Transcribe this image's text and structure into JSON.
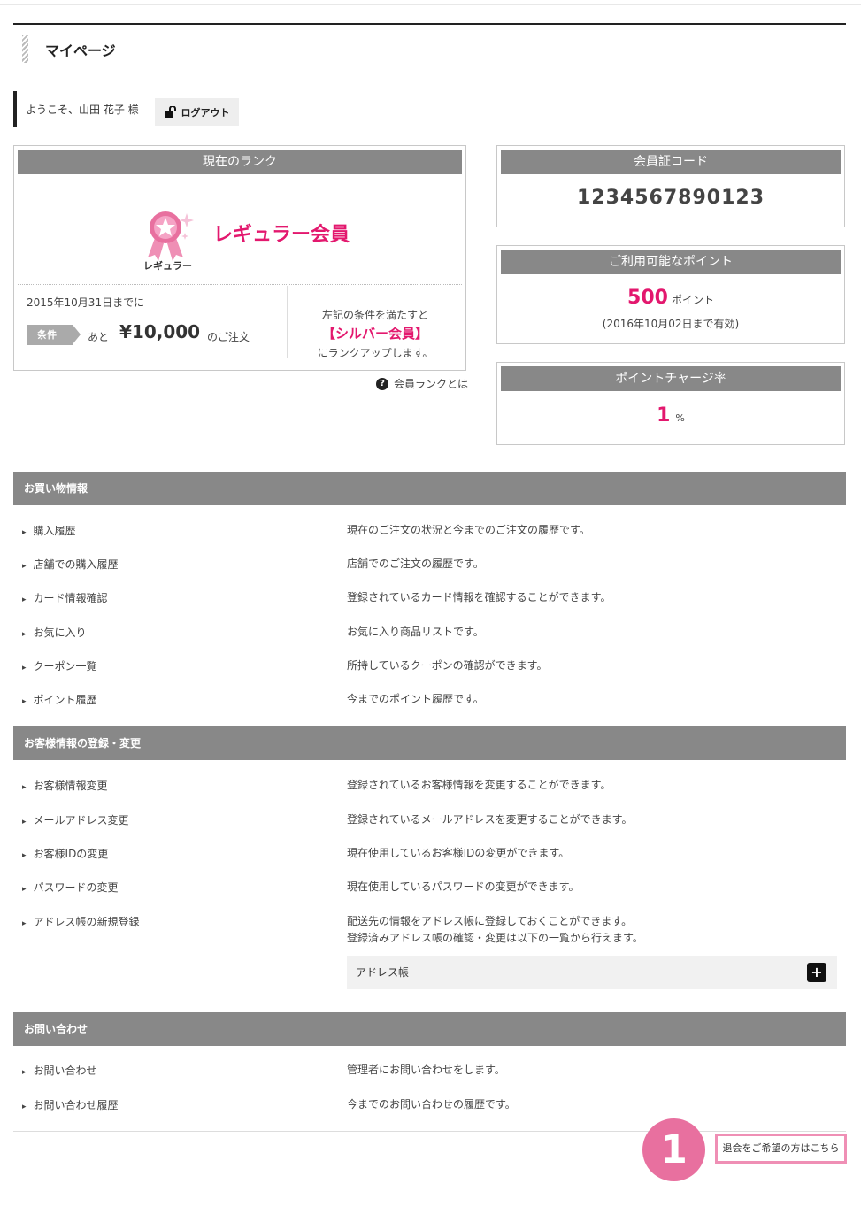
{
  "header": {
    "title": "マイページ"
  },
  "welcome": {
    "text": "ようこそ、山田 花子 様",
    "logout_label": "ログアウト"
  },
  "rank": {
    "heading": "現在のランク",
    "badge_label": "レギュラー",
    "name": "レギュラー会員",
    "deadline": "2015年10月31日までに",
    "condition_tag": "条件",
    "condition_pre": "あと",
    "condition_amount": "¥10,000",
    "condition_post": "のご注文",
    "upgrade_line1": "左記の条件を満たすと",
    "upgrade_rank": "【シルバー会員】",
    "upgrade_line3": "にランクアップします。",
    "help_link": "会員ランクとは"
  },
  "member_code": {
    "heading": "会員証コード",
    "value": "1234567890123"
  },
  "points": {
    "heading": "ご利用可能なポイント",
    "value": "500",
    "unit": "ポイント",
    "expiry": "(2016年10月02日まで有効)"
  },
  "charge_rate": {
    "heading": "ポイントチャージ率",
    "value": "1",
    "unit": "%"
  },
  "sections": [
    {
      "title": "お買い物情報",
      "items": [
        {
          "name": "購入履歴",
          "desc": "現在のご注文の状況と今までのご注文の履歴です。"
        },
        {
          "name": "店舗での購入履歴",
          "desc": "店舗でのご注文の履歴です。"
        },
        {
          "name": "カード情報確認",
          "desc": "登録されているカード情報を確認することができます。"
        },
        {
          "name": "お気に入り",
          "desc": "お気に入り商品リストです。"
        },
        {
          "name": "クーポン一覧",
          "desc": "所持しているクーポンの確認ができます。"
        },
        {
          "name": "ポイント履歴",
          "desc": "今までのポイント履歴です。"
        }
      ]
    },
    {
      "title": "お客様情報の登録・変更",
      "items": [
        {
          "name": "お客様情報変更",
          "desc": "登録されているお客様情報を変更することができます。"
        },
        {
          "name": "メールアドレス変更",
          "desc": "登録されているメールアドレスを変更することができます。"
        },
        {
          "name": "お客様IDの変更",
          "desc": "現在使用しているお客様IDの変更ができます。"
        },
        {
          "name": "パスワードの変更",
          "desc": "現在使用しているパスワードの変更ができます。"
        },
        {
          "name": "アドレス帳の新規登録",
          "desc": "配送先の情報をアドレス帳に登録しておくことができます。",
          "desc2": "登録済みアドレス帳の確認・変更は以下の一覧から行えます。"
        }
      ],
      "address_book": {
        "label": "アドレス帳",
        "toggle": "+"
      }
    },
    {
      "title": "お問い合わせ",
      "items": [
        {
          "name": "お問い合わせ",
          "desc": "管理者にお問い合わせをします。"
        },
        {
          "name": "お問い合わせ履歴",
          "desc": "今までのお問い合わせの履歴です。"
        }
      ]
    }
  ],
  "footer": {
    "step_number": "1",
    "withdraw_label": "退会をご希望の方はこちら"
  },
  "colors": {
    "accent": "#e3186e",
    "section_bg": "#888888",
    "highlight": "#ef8fb5"
  }
}
